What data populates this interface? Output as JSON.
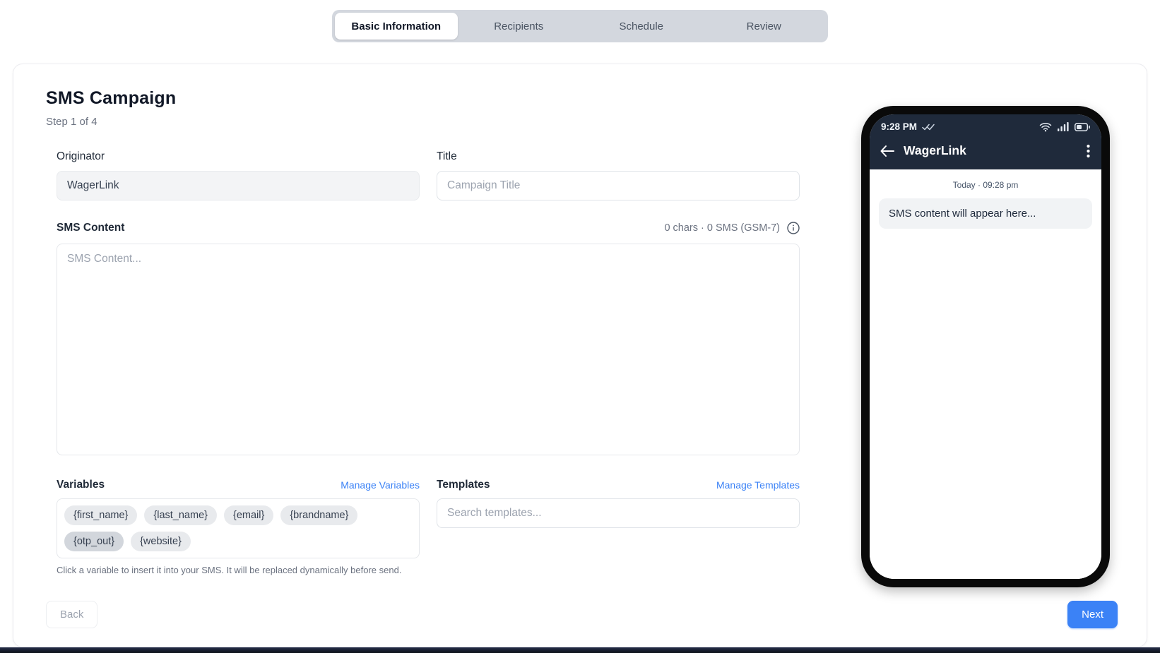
{
  "tabs": [
    {
      "label": "Basic Information",
      "active": true
    },
    {
      "label": "Recipients",
      "active": false
    },
    {
      "label": "Schedule",
      "active": false
    },
    {
      "label": "Review",
      "active": false
    }
  ],
  "page": {
    "title": "SMS Campaign",
    "step": "Step 1 of 4"
  },
  "form": {
    "originator": {
      "label": "Originator",
      "value": "WagerLink"
    },
    "title_field": {
      "label": "Title",
      "placeholder": "Campaign Title"
    },
    "sms": {
      "label": "SMS Content",
      "counter": "0 chars · 0 SMS (GSM-7)",
      "info_icon": "info-circle",
      "placeholder": "SMS Content..."
    },
    "variables": {
      "label": "Variables",
      "manage_link": "Manage Variables",
      "chips": [
        {
          "label": "{first_name}"
        },
        {
          "label": "{last_name}"
        },
        {
          "label": "{email}"
        },
        {
          "label": "{brandname}"
        },
        {
          "label": "{otp_out}",
          "active": true
        },
        {
          "label": "{website}"
        }
      ],
      "helper": "Click a variable to insert it into your SMS. It will be replaced dynamically before send."
    },
    "templates": {
      "label": "Templates",
      "manage_link": "Manage Templates",
      "search_placeholder": "Search templates..."
    }
  },
  "footer": {
    "back": "Back",
    "next": "Next"
  },
  "phone": {
    "status": {
      "time": "9:28 PM",
      "delivery_icon": "double-check",
      "right_icons": [
        "wifi-icon",
        "signal-bars-icon",
        "battery-icon"
      ]
    },
    "header": {
      "back_icon": "arrow-left",
      "title": "WagerLink",
      "menu_icon": "kebab-menu"
    },
    "conversation": {
      "timestamp": "Today · 09:28 pm",
      "bubble": "SMS content will appear here..."
    }
  },
  "colors": {
    "accent": "#3b82f6",
    "tab_bar_bg": "#d3d7de",
    "phone_header": "#1f2a3b"
  }
}
